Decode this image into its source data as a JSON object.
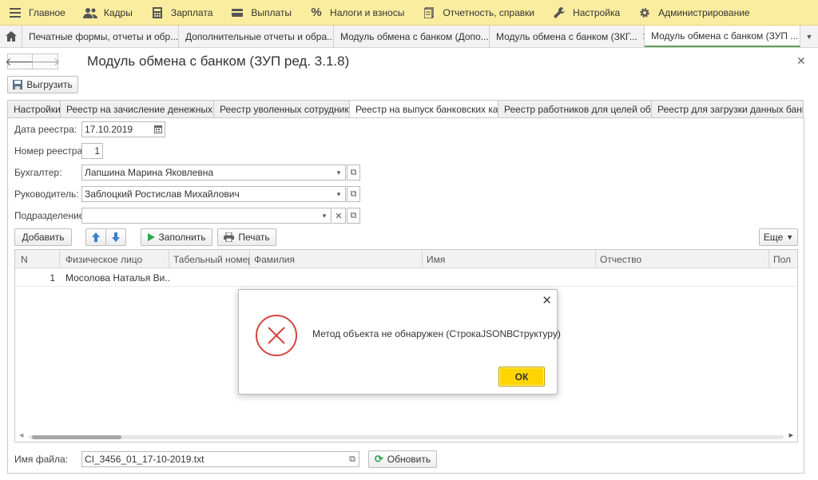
{
  "menu": {
    "items": [
      {
        "icon": "hamburger-icon",
        "label": "Главное"
      },
      {
        "icon": "people-icon",
        "label": "Кадры"
      },
      {
        "icon": "calculator-icon",
        "label": "Зарплата"
      },
      {
        "icon": "wallet-icon",
        "label": "Выплаты"
      },
      {
        "icon": "percent-icon",
        "label": "Налоги и взносы"
      },
      {
        "icon": "report-icon",
        "label": "Отчетность, справки"
      },
      {
        "icon": "wrench-icon",
        "label": "Настройка"
      },
      {
        "icon": "gear-icon",
        "label": "Администрирование"
      }
    ]
  },
  "tabs": [
    {
      "label": "Печатные формы, отчеты и обр..."
    },
    {
      "label": "Дополнительные отчеты и обра..."
    },
    {
      "label": "Модуль обмена с банком (Допо..."
    },
    {
      "label": "Модуль обмена с банком (ЗКГ..."
    },
    {
      "label": "Модуль обмена с банком (ЗУП ..."
    }
  ],
  "form": {
    "title": "Модуль обмена с банком (ЗУП ред. 3.1.8)",
    "upload_label": "Выгрузить",
    "tabs": [
      "Настройки",
      "Реестр на зачисление денежных с...",
      "Реестр уволенных сотрудников",
      "Реестр на выпуск банковских карт",
      "Реестр работников для целей объ...",
      "Реестр для загрузки данных банк..."
    ],
    "fields": {
      "date_label": "Дата реестра:",
      "date_value": "17.10.2019",
      "number_label": "Номер реестра:",
      "number_value": "1",
      "accountant_label": "Бухгалтер:",
      "accountant_value": "Лапшина Марина Яковлевна",
      "director_label": "Руководитель:",
      "director_value": "Заблоцкий Ростислав Михайлович",
      "department_label": "Подразделение:",
      "department_value": ""
    },
    "toolbar": {
      "add_label": "Добавить",
      "fill_label": "Заполнить",
      "print_label": "Печать",
      "more_label": "Еще"
    },
    "table": {
      "columns": [
        "N",
        "Физическое лицо",
        "Табельный номер",
        "Фамилия",
        "Имя",
        "Отчество",
        "Пол"
      ],
      "rows": [
        [
          "1",
          "Мосолова Наталья Ви...",
          "",
          "",
          "",
          "",
          ""
        ]
      ]
    },
    "file_label": "Имя файла:",
    "file_value": "CI_3456_01_17-10-2019.txt",
    "refresh_label": "Обновить"
  },
  "dialog": {
    "message": "Метод объекта не обнаружен (СтрокаJSONВСтруктуру)",
    "ok_label": "ОК"
  }
}
